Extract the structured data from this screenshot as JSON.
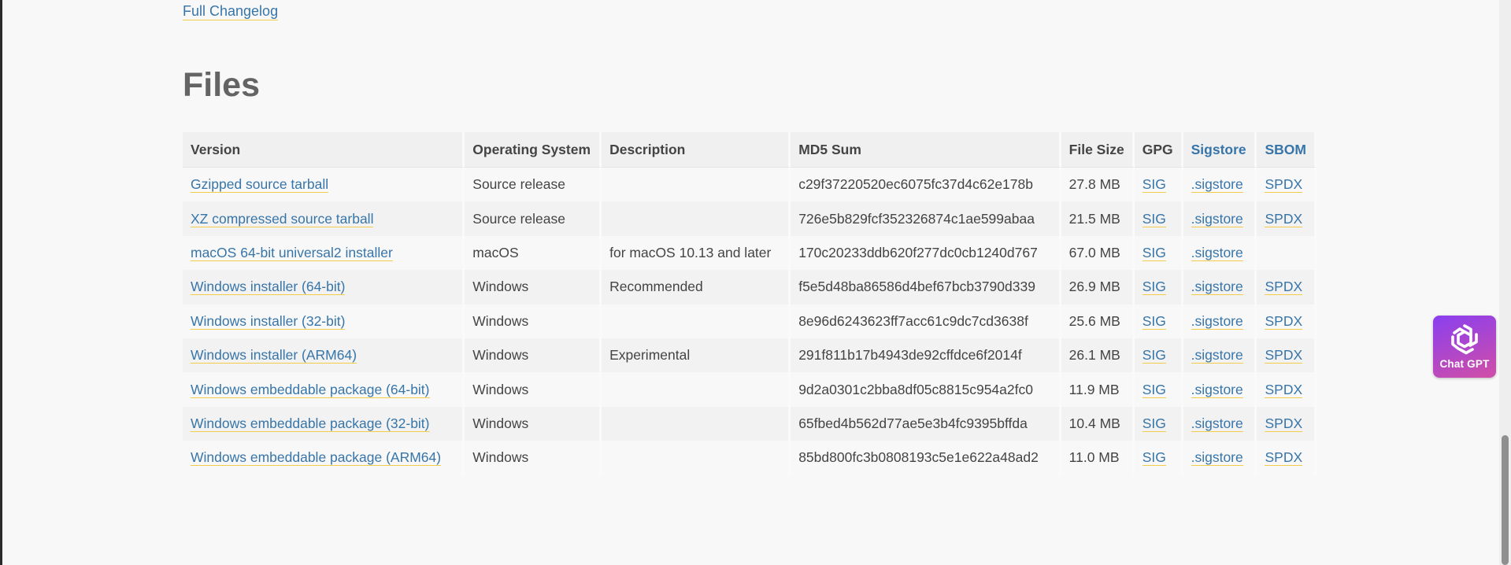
{
  "page": {
    "changelog_link": "Full Changelog",
    "section_title": "Files"
  },
  "table": {
    "headers": {
      "version": "Version",
      "os": "Operating System",
      "description": "Description",
      "md5": "MD5 Sum",
      "size": "File Size",
      "gpg": "GPG",
      "sigstore": "Sigstore",
      "sbom": "SBOM"
    },
    "rows": [
      {
        "version": "Gzipped source tarball",
        "os": "Source release",
        "description": "",
        "md5": "c29f37220520ec6075fc37d4c62e178b",
        "size": "27.8 MB",
        "gpg": "SIG",
        "sigstore": ".sigstore",
        "sbom": "SPDX"
      },
      {
        "version": "XZ compressed source tarball",
        "os": "Source release",
        "description": "",
        "md5": "726e5b829fcf352326874c1ae599abaa",
        "size": "21.5 MB",
        "gpg": "SIG",
        "sigstore": ".sigstore",
        "sbom": "SPDX"
      },
      {
        "version": "macOS 64-bit universal2 installer",
        "os": "macOS",
        "description": "for macOS 10.13 and later",
        "md5": "170c20233ddb620f277dc0cb1240d767",
        "size": "67.0 MB",
        "gpg": "SIG",
        "sigstore": ".sigstore",
        "sbom": ""
      },
      {
        "version": "Windows installer (64-bit)",
        "os": "Windows",
        "description": "Recommended",
        "md5": "f5e5d48ba86586d4bef67bcb3790d339",
        "size": "26.9 MB",
        "gpg": "SIG",
        "sigstore": ".sigstore",
        "sbom": "SPDX"
      },
      {
        "version": "Windows installer (32-bit)",
        "os": "Windows",
        "description": "",
        "md5": "8e96d6243623ff7acc61c9dc7cd3638f",
        "size": "25.6 MB",
        "gpg": "SIG",
        "sigstore": ".sigstore",
        "sbom": "SPDX"
      },
      {
        "version": "Windows installer (ARM64)",
        "os": "Windows",
        "description": "Experimental",
        "md5": "291f811b17b4943de92cffdce6f2014f",
        "size": "26.1 MB",
        "gpg": "SIG",
        "sigstore": ".sigstore",
        "sbom": "SPDX"
      },
      {
        "version": "Windows embeddable package (64-bit)",
        "os": "Windows",
        "description": "",
        "md5": "9d2a0301c2bba8df05c8815c954a2fc0",
        "size": "11.9 MB",
        "gpg": "SIG",
        "sigstore": ".sigstore",
        "sbom": "SPDX"
      },
      {
        "version": "Windows embeddable package (32-bit)",
        "os": "Windows",
        "description": "",
        "md5": "65fbed4b562d77ae5e3b4fc9395bffda",
        "size": "10.4 MB",
        "gpg": "SIG",
        "sigstore": ".sigstore",
        "sbom": "SPDX"
      },
      {
        "version": "Windows embeddable package (ARM64)",
        "os": "Windows",
        "description": "",
        "md5": "85bd800fc3b0808193c5e1e622a48ad2",
        "size": "11.0 MB",
        "gpg": "SIG",
        "sigstore": ".sigstore",
        "sbom": "SPDX"
      }
    ]
  },
  "chat_widget": {
    "label": "Chat GPT",
    "icon": "openai-logo-icon"
  },
  "colors": {
    "link": "#3775a9",
    "link_underline": "#f3cc4a",
    "widget_gradient_start": "#8a3ff0",
    "widget_gradient_end": "#d14ea6"
  }
}
